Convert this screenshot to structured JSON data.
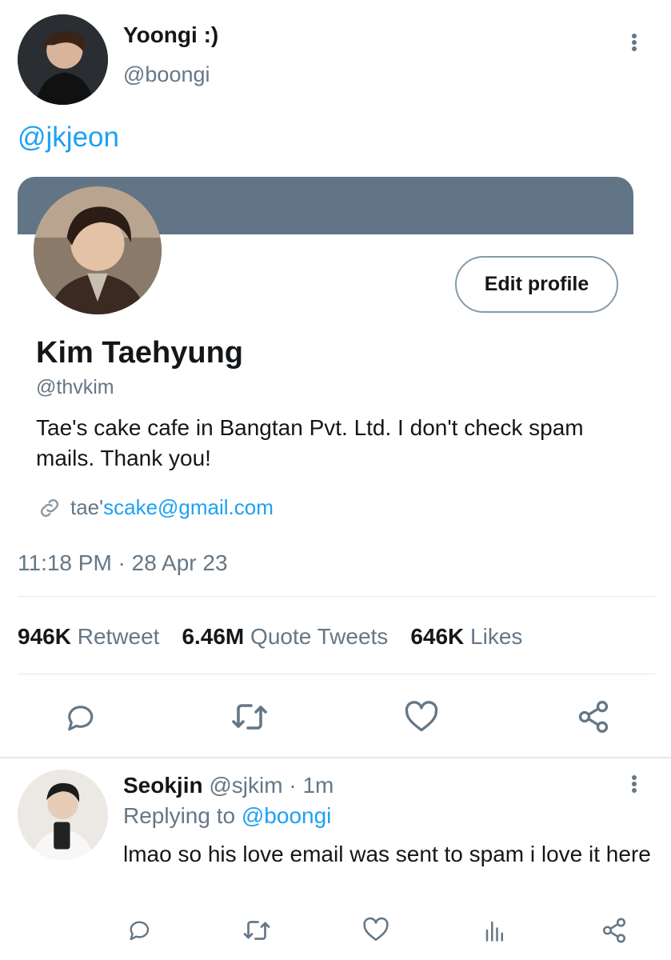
{
  "tweet": {
    "author_name": "Yoongi :)",
    "author_handle": "@boongi",
    "mention": "@jkjeon",
    "embedded_profile": {
      "name": "Kim Taehyung",
      "handle": "@thvkim",
      "bio": "Tae's cake cafe in Bangtan Pvt. Ltd. I don't check spam mails. Thank you!",
      "link_prefix": "tae'",
      "link_rest": "scake@gmail.com",
      "edit_button": "Edit profile"
    },
    "timestamp": "11:18 PM · 28 Apr 23",
    "stats": [
      {
        "count": "946K",
        "label": "Retweet"
      },
      {
        "count": "6.46M",
        "label": "Quote Tweets"
      },
      {
        "count": "646K",
        "label": "Likes"
      }
    ],
    "actions": [
      "reply-icon",
      "retweet-icon",
      "like-icon",
      "share-icon"
    ]
  },
  "reply": {
    "author_name": "Seokjin",
    "author_handle": "@sjkim",
    "time": "· 1m",
    "replying_prefix": "Replying to",
    "replying_handle": "@boongi",
    "text": "lmao so his love email was sent to spam i love it here",
    "actions": [
      "reply-icon",
      "retweet-icon",
      "like-icon",
      "analytics-icon",
      "share-icon"
    ]
  },
  "colors": {
    "accent": "#1da1f2",
    "banner": "#627587",
    "muted": "#657786",
    "divider": "#e1e8ed"
  }
}
